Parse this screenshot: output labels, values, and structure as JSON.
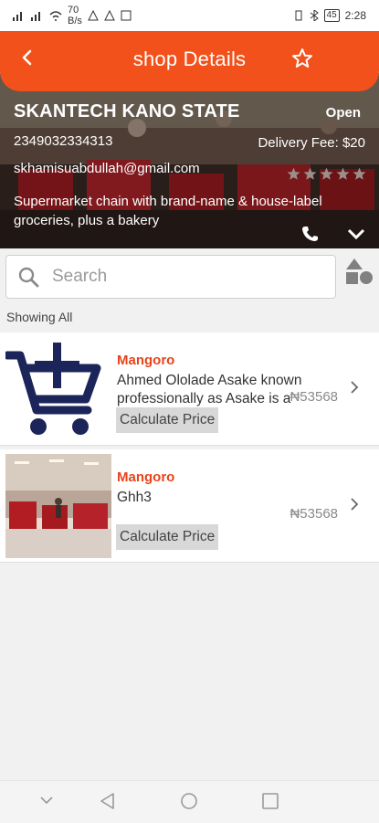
{
  "status_bar": {
    "left_text": "70",
    "left_sub": "B/s",
    "battery": "45",
    "time": "2:28"
  },
  "header": {
    "title": "shop Details",
    "back_icon": "chevron-left-icon",
    "favorite_icon": "star-outline-icon",
    "color": "#f2511b"
  },
  "shop": {
    "name": "SKANTECH KANO STATE",
    "status": "Open",
    "phone": "2349032334313",
    "delivery_fee": "Delivery Fee: $20",
    "email": "skhamisuabdullah@gmail.com",
    "description": "Supermarket chain with brand-name & house-label groceries, plus a bakery",
    "rating": 0,
    "rating_max": 5
  },
  "search": {
    "placeholder": "Search"
  },
  "filter_label": "Showing All",
  "products": [
    {
      "brand": "Mangoro",
      "name": "Ahmed Ololade Asake known professionally as Asake is a Nigerian singer",
      "price": "₦53568",
      "button": "Calculate Price",
      "image": "cart-plus-icon"
    },
    {
      "brand": "Mangoro",
      "name": "Ghh3",
      "price": "₦53568",
      "button": "Calculate Price",
      "image": "supermarket-photo"
    }
  ],
  "colors": {
    "accent": "#f2511b",
    "brand_text": "#e8431b",
    "cart_icon": "#1b2559"
  }
}
